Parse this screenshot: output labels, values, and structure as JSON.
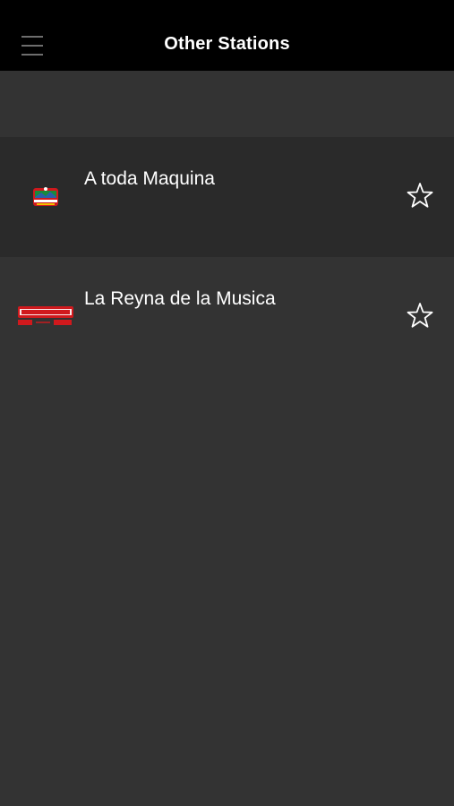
{
  "header": {
    "title": "Other Stations",
    "menu_icon": "hamburger-menu-icon"
  },
  "stations": [
    {
      "name": "A toda Maquina",
      "logo": "radio-la-musiquera-logo",
      "favorite": false,
      "favorite_icon": "star-outline-icon"
    },
    {
      "name": "La Reyna de la Musica",
      "logo": "la-musiquera-logo",
      "favorite": false,
      "favorite_icon": "star-outline-icon"
    }
  ],
  "colors": {
    "navbar": "#000000",
    "background": "#333333",
    "highlighted_row": "#2a2a2a",
    "logo_red": "#d0191d"
  }
}
